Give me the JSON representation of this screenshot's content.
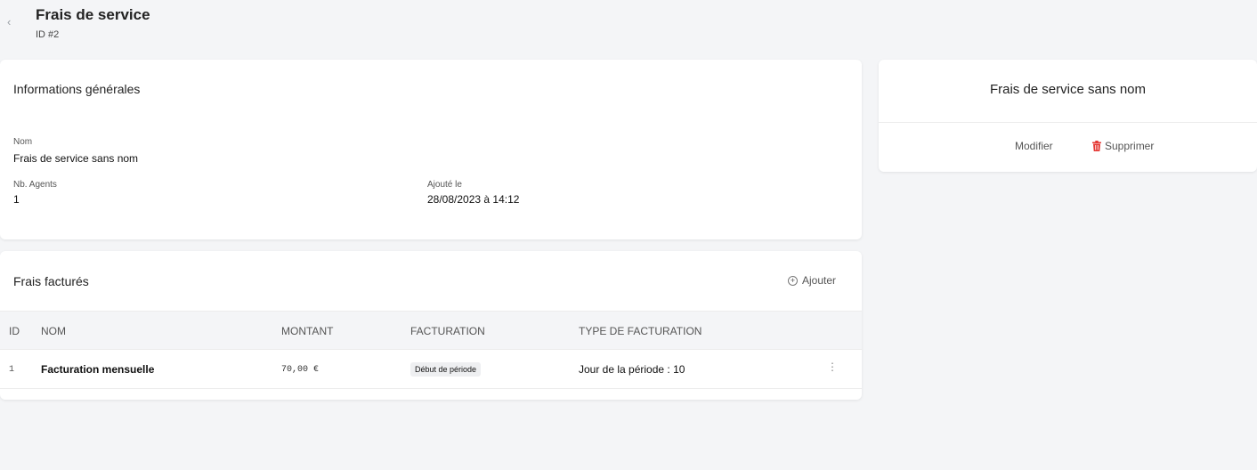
{
  "header": {
    "title": "Frais de service",
    "subtitle": "ID #2",
    "back_glyph": "‹"
  },
  "info": {
    "title": "Informations générales",
    "name_label": "Nom",
    "name_value": "Frais de service sans nom",
    "agents_label": "Nb. Agents",
    "agents_value": "1",
    "added_label": "Ajouté le",
    "added_value": "28/08/2023 à 14:12"
  },
  "fees": {
    "title": "Frais facturés",
    "add_label": "Ajouter",
    "add_glyph": "+",
    "columns": [
      "ID",
      "NOM",
      "MONTANT",
      "FACTURATION",
      "TYPE DE FACTURATION"
    ],
    "rows": [
      {
        "id": "1",
        "name": "Facturation mensuelle",
        "amount": "70,00 €",
        "billing": "Début de période",
        "billing_type": "Jour de la période : 10"
      }
    ],
    "more_glyph": "⋮"
  },
  "side": {
    "title": "Frais de service sans nom",
    "edit_label": "Modifier",
    "delete_label": "Supprimer",
    "delete_color": "#e53935"
  }
}
